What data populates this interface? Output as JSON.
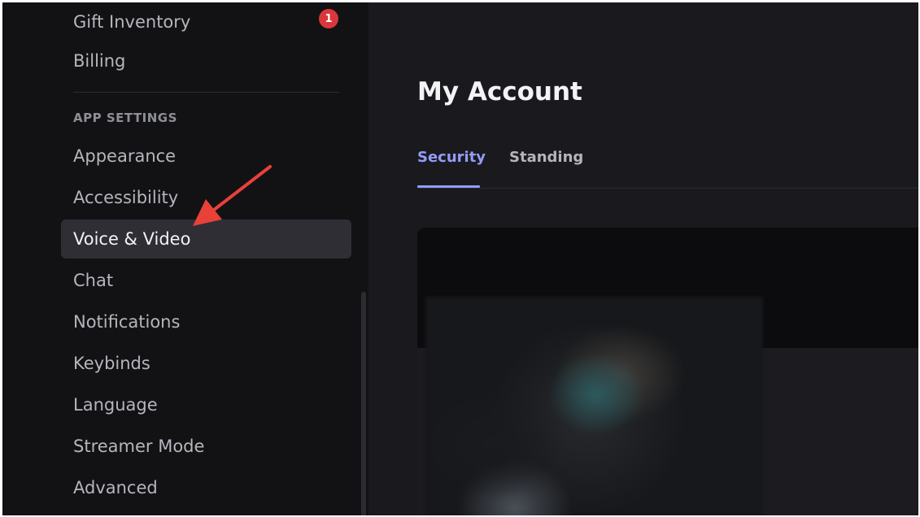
{
  "sidebar": {
    "items_top": [
      {
        "label": "Gift Inventory",
        "badge": "1"
      },
      {
        "label": "Billing"
      }
    ],
    "section_header": "APP SETTINGS",
    "items": [
      {
        "label": "Appearance"
      },
      {
        "label": "Accessibility"
      },
      {
        "label": "Voice & Video",
        "selected": true
      },
      {
        "label": "Chat"
      },
      {
        "label": "Notifications"
      },
      {
        "label": "Keybinds"
      },
      {
        "label": "Language"
      },
      {
        "label": "Streamer Mode"
      },
      {
        "label": "Advanced"
      }
    ]
  },
  "main": {
    "title": "My Account",
    "tabs": [
      {
        "label": "Security",
        "active": true
      },
      {
        "label": "Standing",
        "active": false
      }
    ]
  },
  "annotation": {
    "arrow_color": "#e8413a",
    "points_to": "Voice & Video"
  },
  "colors": {
    "accent": "#949cf7",
    "badge": "#da373c",
    "sidebar_bg": "#121214",
    "main_bg": "#1a1a1e",
    "selected_bg": "#2e2e34"
  }
}
